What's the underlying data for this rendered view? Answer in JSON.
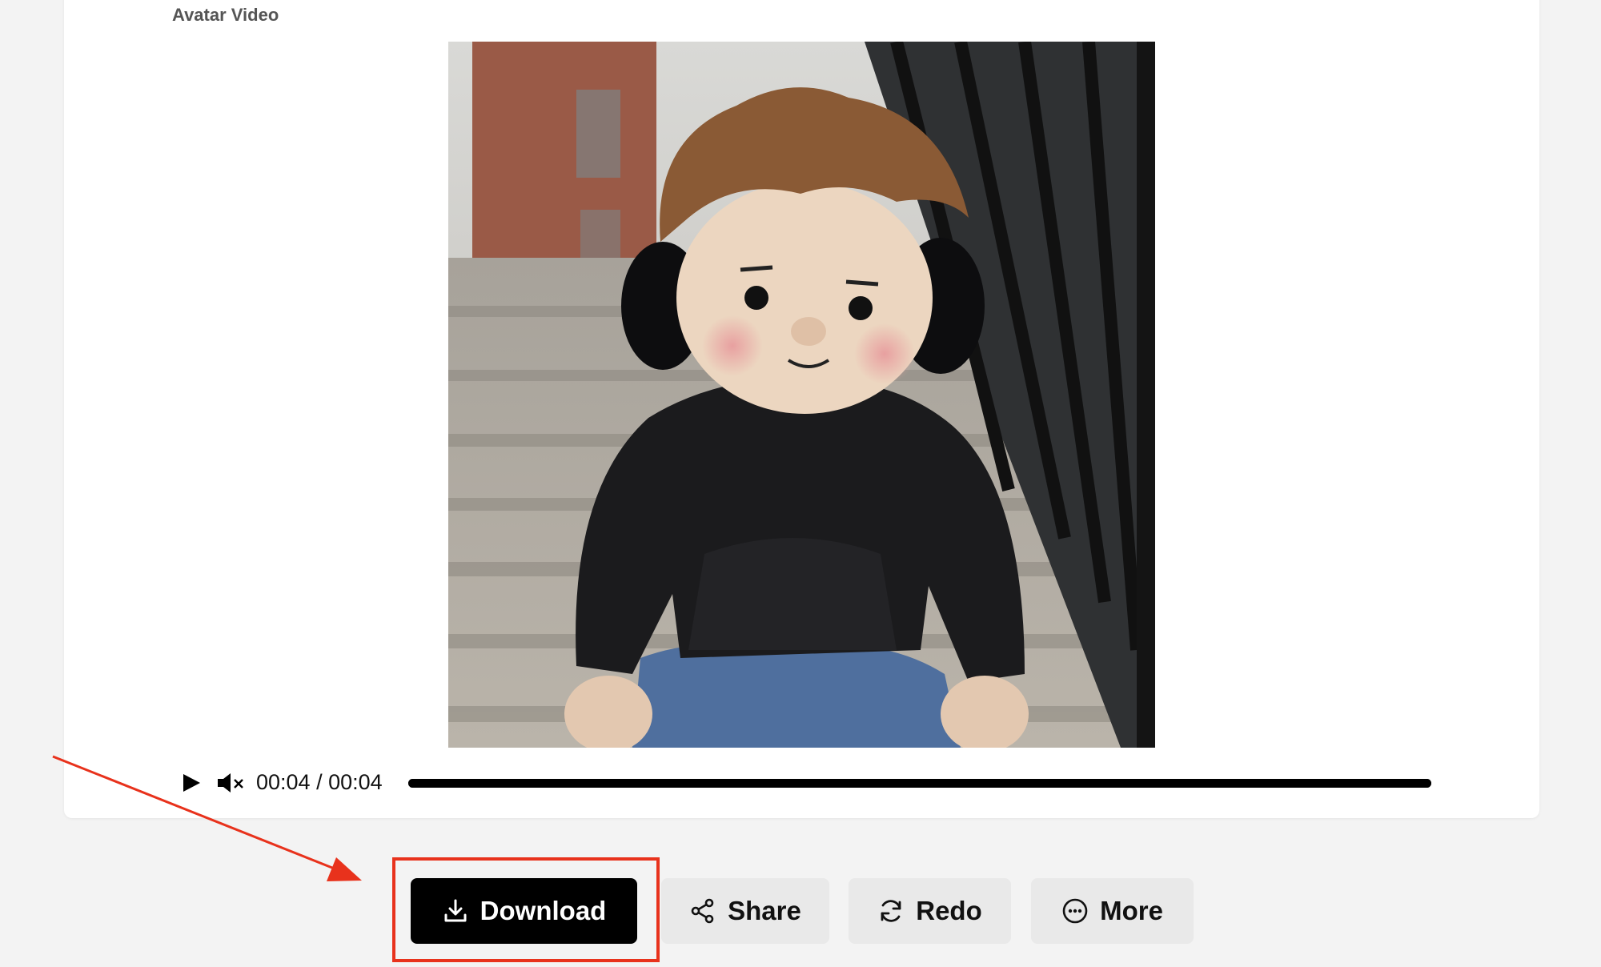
{
  "section": {
    "label": "Avatar Video"
  },
  "player": {
    "current_time": "00:04",
    "duration": "00:04",
    "time_display": "00:04 / 00:04",
    "progress_fraction": 1.0,
    "play_icon": "play-icon",
    "mute_icon": "muted-speaker-icon"
  },
  "actions": {
    "download_label": "Download",
    "share_label": "Share",
    "redo_label": "Redo",
    "more_label": "More"
  },
  "colors": {
    "highlight": "#e8321c",
    "primary_button": "#000000",
    "secondary_button": "#e9e9e9",
    "background": "#f3f3f3"
  }
}
